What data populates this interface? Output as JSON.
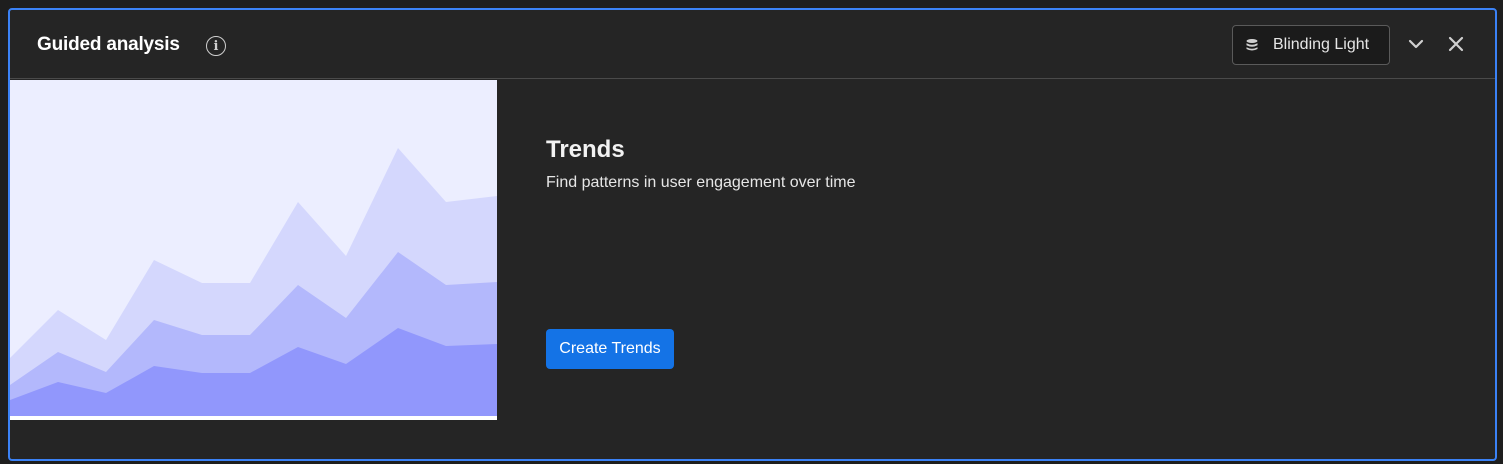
{
  "panel": {
    "title": "Guided analysis",
    "info_icon": "info-icon",
    "dataset_button": {
      "icon": "database-icon",
      "label": "Blinding Light"
    },
    "collapse_icon": "chevron-down-icon",
    "close_icon": "close-icon"
  },
  "content": {
    "title": "Trends",
    "description": "Find patterns in user engagement over time",
    "primary_button_label": "Create Trends"
  },
  "illustration": {
    "icon": "trends-area-illustration",
    "colors": {
      "background": "#eceeff",
      "layer_top": "#d4d7fd",
      "layer_mid": "#b3b8fc",
      "layer_bottom": "#9197fc"
    }
  },
  "colors": {
    "panel_background": "#252525",
    "panel_border": "#3b82f6",
    "accent": "#1473e6"
  }
}
